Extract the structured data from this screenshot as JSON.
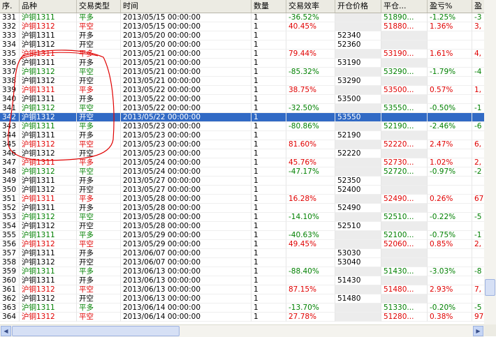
{
  "columns": [
    "序.",
    "品种",
    "交易类型",
    "时间",
    "数量",
    "交易效率",
    "开仓价格",
    "平仓...",
    "盈亏%",
    "盈"
  ],
  "selected_row": "342",
  "colors": {
    "profit": "#e00000",
    "loss": "#008000",
    "selection": "#316ac5"
  },
  "rows": [
    {
      "seq": "331",
      "inst": "沪铜1311",
      "type": "平多",
      "time": "2013/05/15 00:00:00",
      "qty": "1",
      "eff": "-36.52%",
      "open": "",
      "close": "51890...",
      "pnl": "-1.25%",
      "extra": "-3",
      "color": "green"
    },
    {
      "seq": "332",
      "inst": "沪铜1312",
      "type": "平空",
      "time": "2013/05/15 00:00:00",
      "qty": "1",
      "eff": "40.45%",
      "open": "",
      "close": "51880...",
      "pnl": "1.36%",
      "extra": "3,",
      "color": "red"
    },
    {
      "seq": "333",
      "inst": "沪铜1311",
      "type": "开多",
      "time": "2013/05/20 00:00:00",
      "qty": "1",
      "eff": "",
      "open": "52340",
      "close": "",
      "pnl": "",
      "extra": "",
      "color": "black"
    },
    {
      "seq": "334",
      "inst": "沪铜1312",
      "type": "开空",
      "time": "2013/05/20 00:00:00",
      "qty": "1",
      "eff": "",
      "open": "52360",
      "close": "",
      "pnl": "",
      "extra": "",
      "color": "black"
    },
    {
      "seq": "335",
      "inst": "沪铜1311",
      "type": "平多",
      "time": "2013/05/21 00:00:00",
      "qty": "1",
      "eff": "79.44%",
      "open": "",
      "close": "53190...",
      "pnl": "1.61%",
      "extra": "4,",
      "color": "red"
    },
    {
      "seq": "336",
      "inst": "沪铜1311",
      "type": "开多",
      "time": "2013/05/21 00:00:00",
      "qty": "1",
      "eff": "",
      "open": "53190",
      "close": "",
      "pnl": "",
      "extra": "",
      "color": "black"
    },
    {
      "seq": "337",
      "inst": "沪铜1312",
      "type": "平空",
      "time": "2013/05/21 00:00:00",
      "qty": "1",
      "eff": "-85.32%",
      "open": "",
      "close": "53290...",
      "pnl": "-1.79%",
      "extra": "-4",
      "color": "green"
    },
    {
      "seq": "338",
      "inst": "沪铜1312",
      "type": "开空",
      "time": "2013/05/21 00:00:00",
      "qty": "1",
      "eff": "",
      "open": "53290",
      "close": "",
      "pnl": "",
      "extra": "",
      "color": "black"
    },
    {
      "seq": "339",
      "inst": "沪铜1311",
      "type": "平多",
      "time": "2013/05/22 00:00:00",
      "qty": "1",
      "eff": "38.75%",
      "open": "",
      "close": "53500...",
      "pnl": "0.57%",
      "extra": "1,",
      "color": "red"
    },
    {
      "seq": "340",
      "inst": "沪铜1311",
      "type": "开多",
      "time": "2013/05/22 00:00:00",
      "qty": "1",
      "eff": "",
      "open": "53500",
      "close": "",
      "pnl": "",
      "extra": "",
      "color": "black"
    },
    {
      "seq": "341",
      "inst": "沪铜1312",
      "type": "平空",
      "time": "2013/05/22 00:00:00",
      "qty": "1",
      "eff": "-32.50%",
      "open": "",
      "close": "53550...",
      "pnl": "-0.50%",
      "extra": "-1",
      "color": "green"
    },
    {
      "seq": "342",
      "inst": "沪铜1312",
      "type": "开空",
      "time": "2013/05/22 00:00:00",
      "qty": "1",
      "eff": "",
      "open": "53550",
      "close": "",
      "pnl": "",
      "extra": "",
      "color": "black"
    },
    {
      "seq": "343",
      "inst": "沪铜1311",
      "type": "平多",
      "time": "2013/05/23 00:00:00",
      "qty": "1",
      "eff": "-80.86%",
      "open": "",
      "close": "52190...",
      "pnl": "-2.46%",
      "extra": "-6",
      "color": "green"
    },
    {
      "seq": "344",
      "inst": "沪铜1311",
      "type": "开多",
      "time": "2013/05/23 00:00:00",
      "qty": "1",
      "eff": "",
      "open": "52190",
      "close": "",
      "pnl": "",
      "extra": "",
      "color": "black"
    },
    {
      "seq": "345",
      "inst": "沪铜1312",
      "type": "平空",
      "time": "2013/05/23 00:00:00",
      "qty": "1",
      "eff": "81.60%",
      "open": "",
      "close": "52220...",
      "pnl": "2.47%",
      "extra": "6,",
      "color": "red"
    },
    {
      "seq": "346",
      "inst": "沪铜1312",
      "type": "开空",
      "time": "2013/05/23 00:00:00",
      "qty": "1",
      "eff": "",
      "open": "52220",
      "close": "",
      "pnl": "",
      "extra": "",
      "color": "black"
    },
    {
      "seq": "347",
      "inst": "沪铜1311",
      "type": "平多",
      "time": "2013/05/24 00:00:00",
      "qty": "1",
      "eff": "45.76%",
      "open": "",
      "close": "52730...",
      "pnl": "1.02%",
      "extra": "2,",
      "color": "red"
    },
    {
      "seq": "348",
      "inst": "沪铜1312",
      "type": "平空",
      "time": "2013/05/24 00:00:00",
      "qty": "1",
      "eff": "-47.17%",
      "open": "",
      "close": "52720...",
      "pnl": "-0.97%",
      "extra": "-2",
      "color": "green"
    },
    {
      "seq": "349",
      "inst": "沪铜1311",
      "type": "开多",
      "time": "2013/05/27 00:00:00",
      "qty": "1",
      "eff": "",
      "open": "52350",
      "close": "",
      "pnl": "",
      "extra": "",
      "color": "black"
    },
    {
      "seq": "350",
      "inst": "沪铜1312",
      "type": "开空",
      "time": "2013/05/27 00:00:00",
      "qty": "1",
      "eff": "",
      "open": "52400",
      "close": "",
      "pnl": "",
      "extra": "",
      "color": "black"
    },
    {
      "seq": "351",
      "inst": "沪铜1311",
      "type": "平多",
      "time": "2013/05/28 00:00:00",
      "qty": "1",
      "eff": "16.28%",
      "open": "",
      "close": "52490...",
      "pnl": "0.26%",
      "extra": "67",
      "color": "red"
    },
    {
      "seq": "352",
      "inst": "沪铜1311",
      "type": "开多",
      "time": "2013/05/28 00:00:00",
      "qty": "1",
      "eff": "",
      "open": "52490",
      "close": "",
      "pnl": "",
      "extra": "",
      "color": "black"
    },
    {
      "seq": "353",
      "inst": "沪铜1312",
      "type": "平空",
      "time": "2013/05/28 00:00:00",
      "qty": "1",
      "eff": "-14.10%",
      "open": "",
      "close": "52510...",
      "pnl": "-0.22%",
      "extra": "-5",
      "color": "green"
    },
    {
      "seq": "354",
      "inst": "沪铜1312",
      "type": "开空",
      "time": "2013/05/28 00:00:00",
      "qty": "1",
      "eff": "",
      "open": "52510",
      "close": "",
      "pnl": "",
      "extra": "",
      "color": "black"
    },
    {
      "seq": "355",
      "inst": "沪铜1311",
      "type": "平多",
      "time": "2013/05/29 00:00:00",
      "qty": "1",
      "eff": "-40.63%",
      "open": "",
      "close": "52100...",
      "pnl": "-0.75%",
      "extra": "-1",
      "color": "green"
    },
    {
      "seq": "356",
      "inst": "沪铜1312",
      "type": "平空",
      "time": "2013/05/29 00:00:00",
      "qty": "1",
      "eff": "49.45%",
      "open": "",
      "close": "52060...",
      "pnl": "0.85%",
      "extra": "2,",
      "color": "red"
    },
    {
      "seq": "357",
      "inst": "沪铜1311",
      "type": "开多",
      "time": "2013/06/07 00:00:00",
      "qty": "1",
      "eff": "",
      "open": "53030",
      "close": "",
      "pnl": "",
      "extra": "",
      "color": "black"
    },
    {
      "seq": "358",
      "inst": "沪铜1312",
      "type": "开空",
      "time": "2013/06/07 00:00:00",
      "qty": "1",
      "eff": "",
      "open": "53040",
      "close": "",
      "pnl": "",
      "extra": "",
      "color": "black"
    },
    {
      "seq": "359",
      "inst": "沪铜1311",
      "type": "平多",
      "time": "2013/06/13 00:00:00",
      "qty": "1",
      "eff": "-88.40%",
      "open": "",
      "close": "51430...",
      "pnl": "-3.03%",
      "extra": "-8",
      "color": "green"
    },
    {
      "seq": "360",
      "inst": "沪铜1311",
      "type": "开多",
      "time": "2013/06/13 00:00:00",
      "qty": "1",
      "eff": "",
      "open": "51430",
      "close": "",
      "pnl": "",
      "extra": "",
      "color": "black"
    },
    {
      "seq": "361",
      "inst": "沪铜1312",
      "type": "平空",
      "time": "2013/06/13 00:00:00",
      "qty": "1",
      "eff": "87.15%",
      "open": "",
      "close": "51480...",
      "pnl": "2.93%",
      "extra": "7,",
      "color": "red"
    },
    {
      "seq": "362",
      "inst": "沪铜1312",
      "type": "开空",
      "time": "2013/06/13 00:00:00",
      "qty": "1",
      "eff": "",
      "open": "51480",
      "close": "",
      "pnl": "",
      "extra": "",
      "color": "black"
    },
    {
      "seq": "363",
      "inst": "沪铜1311",
      "type": "平多",
      "time": "2013/06/14 00:00:00",
      "qty": "1",
      "eff": "-13.70%",
      "open": "",
      "close": "51330...",
      "pnl": "-0.20%",
      "extra": "-5",
      "color": "green"
    },
    {
      "seq": "364",
      "inst": "沪铜1312",
      "type": "平空",
      "time": "2013/06/14 00:00:00",
      "qty": "1",
      "eff": "27.78%",
      "open": "",
      "close": "51280...",
      "pnl": "0.38%",
      "extra": "97",
      "color": "red"
    }
  ]
}
